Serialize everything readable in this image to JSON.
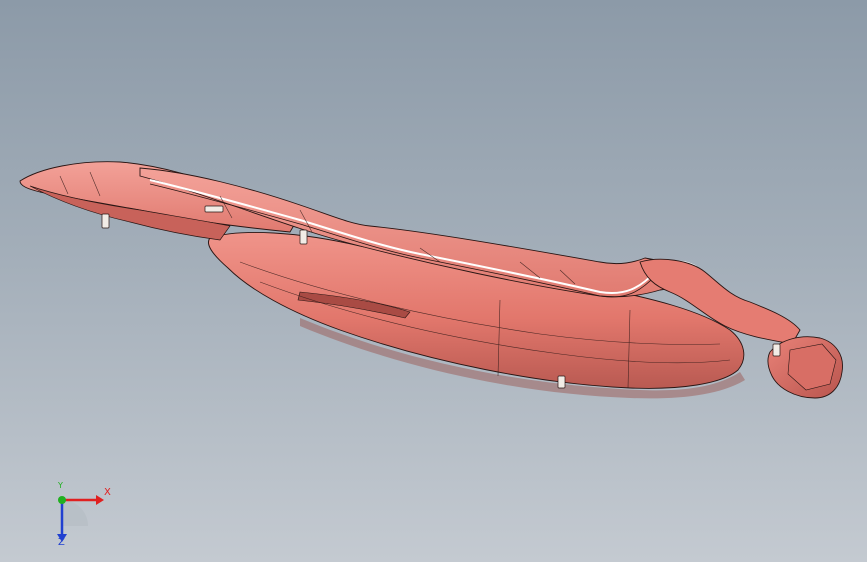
{
  "viewport": {
    "background_top": "#8c9aa8",
    "background_bottom": "#c4cad1"
  },
  "model": {
    "body_color": "#e2776c",
    "highlight_color": "#f0948a",
    "shadow_color": "#b95a52",
    "edge_color": "#2a1614"
  },
  "triad": {
    "x_label": "X",
    "y_label": "Y",
    "z_label": "Z",
    "x_color": "#e02020",
    "y_color": "#20b020",
    "z_color": "#2040d0"
  }
}
